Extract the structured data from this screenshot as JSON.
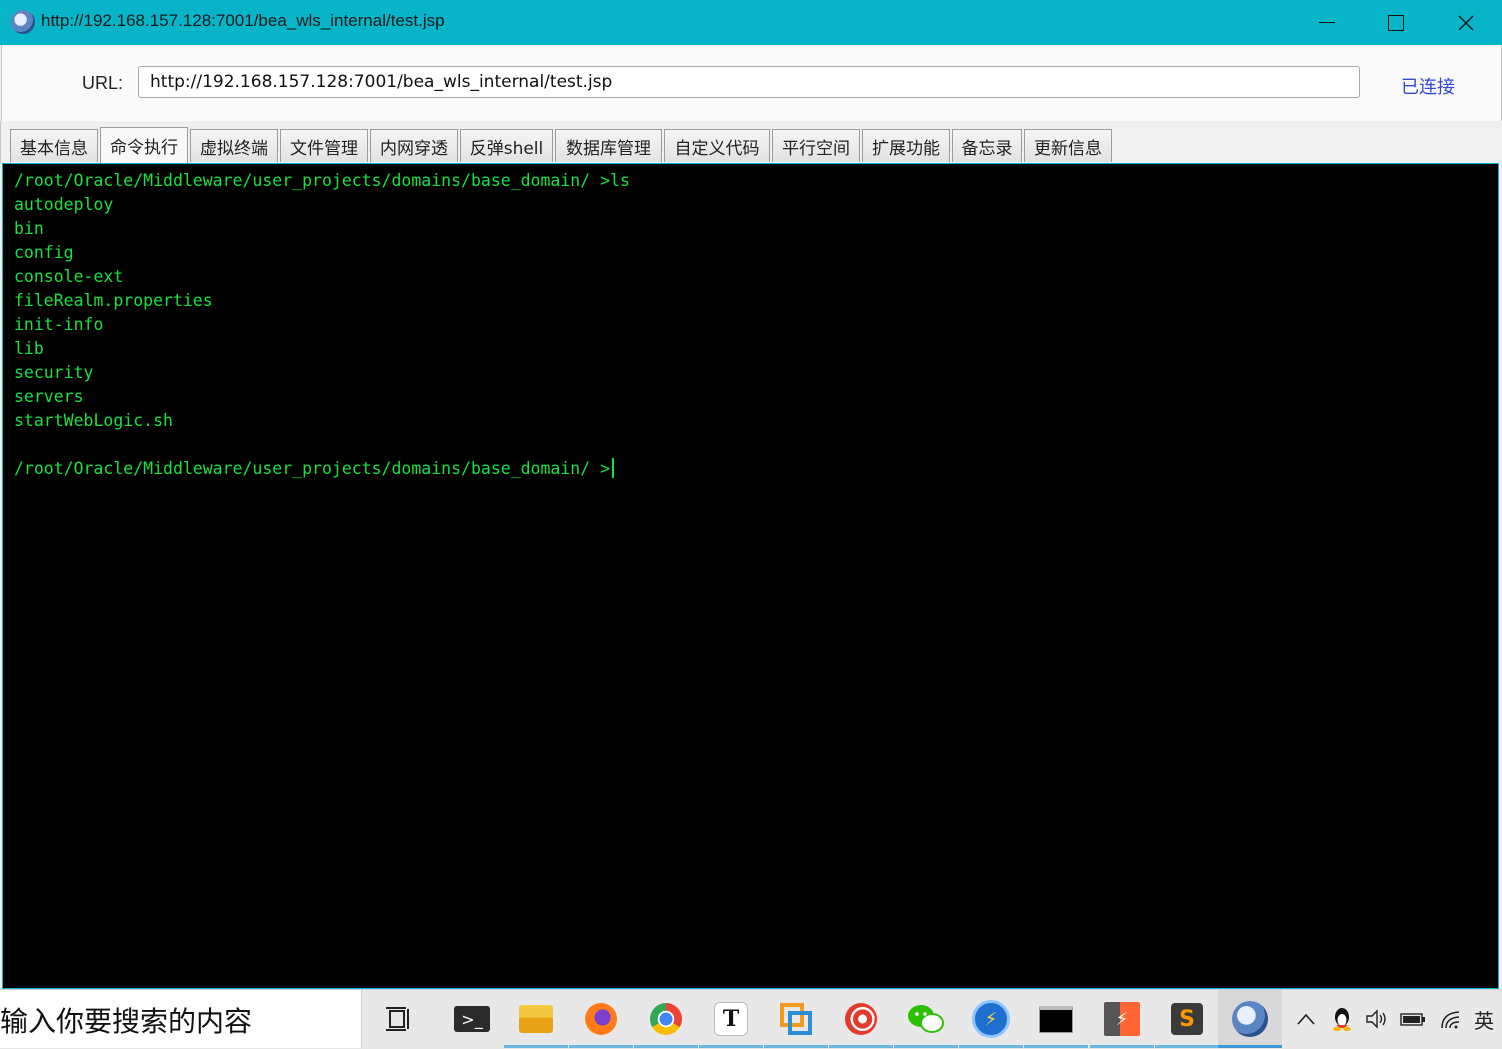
{
  "window": {
    "title": "http://192.168.157.128:7001/bea_wls_internal/test.jsp",
    "icon": "scorpion-logo-icon"
  },
  "urlbar": {
    "label": "URL:",
    "value": "http://192.168.157.128:7001/bea_wls_internal/test.jsp",
    "status": "已连接"
  },
  "tabs": [
    {
      "label": "基本信息"
    },
    {
      "label": "命令执行",
      "active": true
    },
    {
      "label": "虚拟终端"
    },
    {
      "label": "文件管理"
    },
    {
      "label": "内网穿透"
    },
    {
      "label": "反弹shell"
    },
    {
      "label": "数据库管理"
    },
    {
      "label": "自定义代码"
    },
    {
      "label": "平行空间"
    },
    {
      "label": "扩展功能"
    },
    {
      "label": "备忘录"
    },
    {
      "label": "更新信息"
    }
  ],
  "terminal": {
    "lines": [
      "/root/Oracle/Middleware/user_projects/domains/base_domain/ >ls",
      "autodeploy",
      "bin",
      "config",
      "console-ext",
      "fileRealm.properties",
      "init-info",
      "lib",
      "security",
      "servers",
      "startWebLogic.sh",
      ""
    ],
    "prompt": "/root/Oracle/Middleware/user_projects/domains/base_domain/ >",
    "text_color": "#18e040"
  },
  "taskbar": {
    "search_placeholder": "输入你要搜索的内容",
    "apps": [
      {
        "icon": "task-view-icon"
      },
      {
        "icon": "terminal-icon"
      },
      {
        "icon": "file-explorer-icon"
      },
      {
        "icon": "firefox-icon"
      },
      {
        "icon": "chrome-icon"
      },
      {
        "icon": "typora-icon",
        "glyph": "T"
      },
      {
        "icon": "vmware-icon"
      },
      {
        "icon": "snail-app-icon"
      },
      {
        "icon": "wechat-icon"
      },
      {
        "icon": "thunder-icon"
      },
      {
        "icon": "cmd-icon"
      },
      {
        "icon": "burp-suite-icon"
      },
      {
        "icon": "sublime-text-icon"
      },
      {
        "icon": "behinder-icon"
      }
    ],
    "tray": {
      "ime": "英"
    }
  }
}
